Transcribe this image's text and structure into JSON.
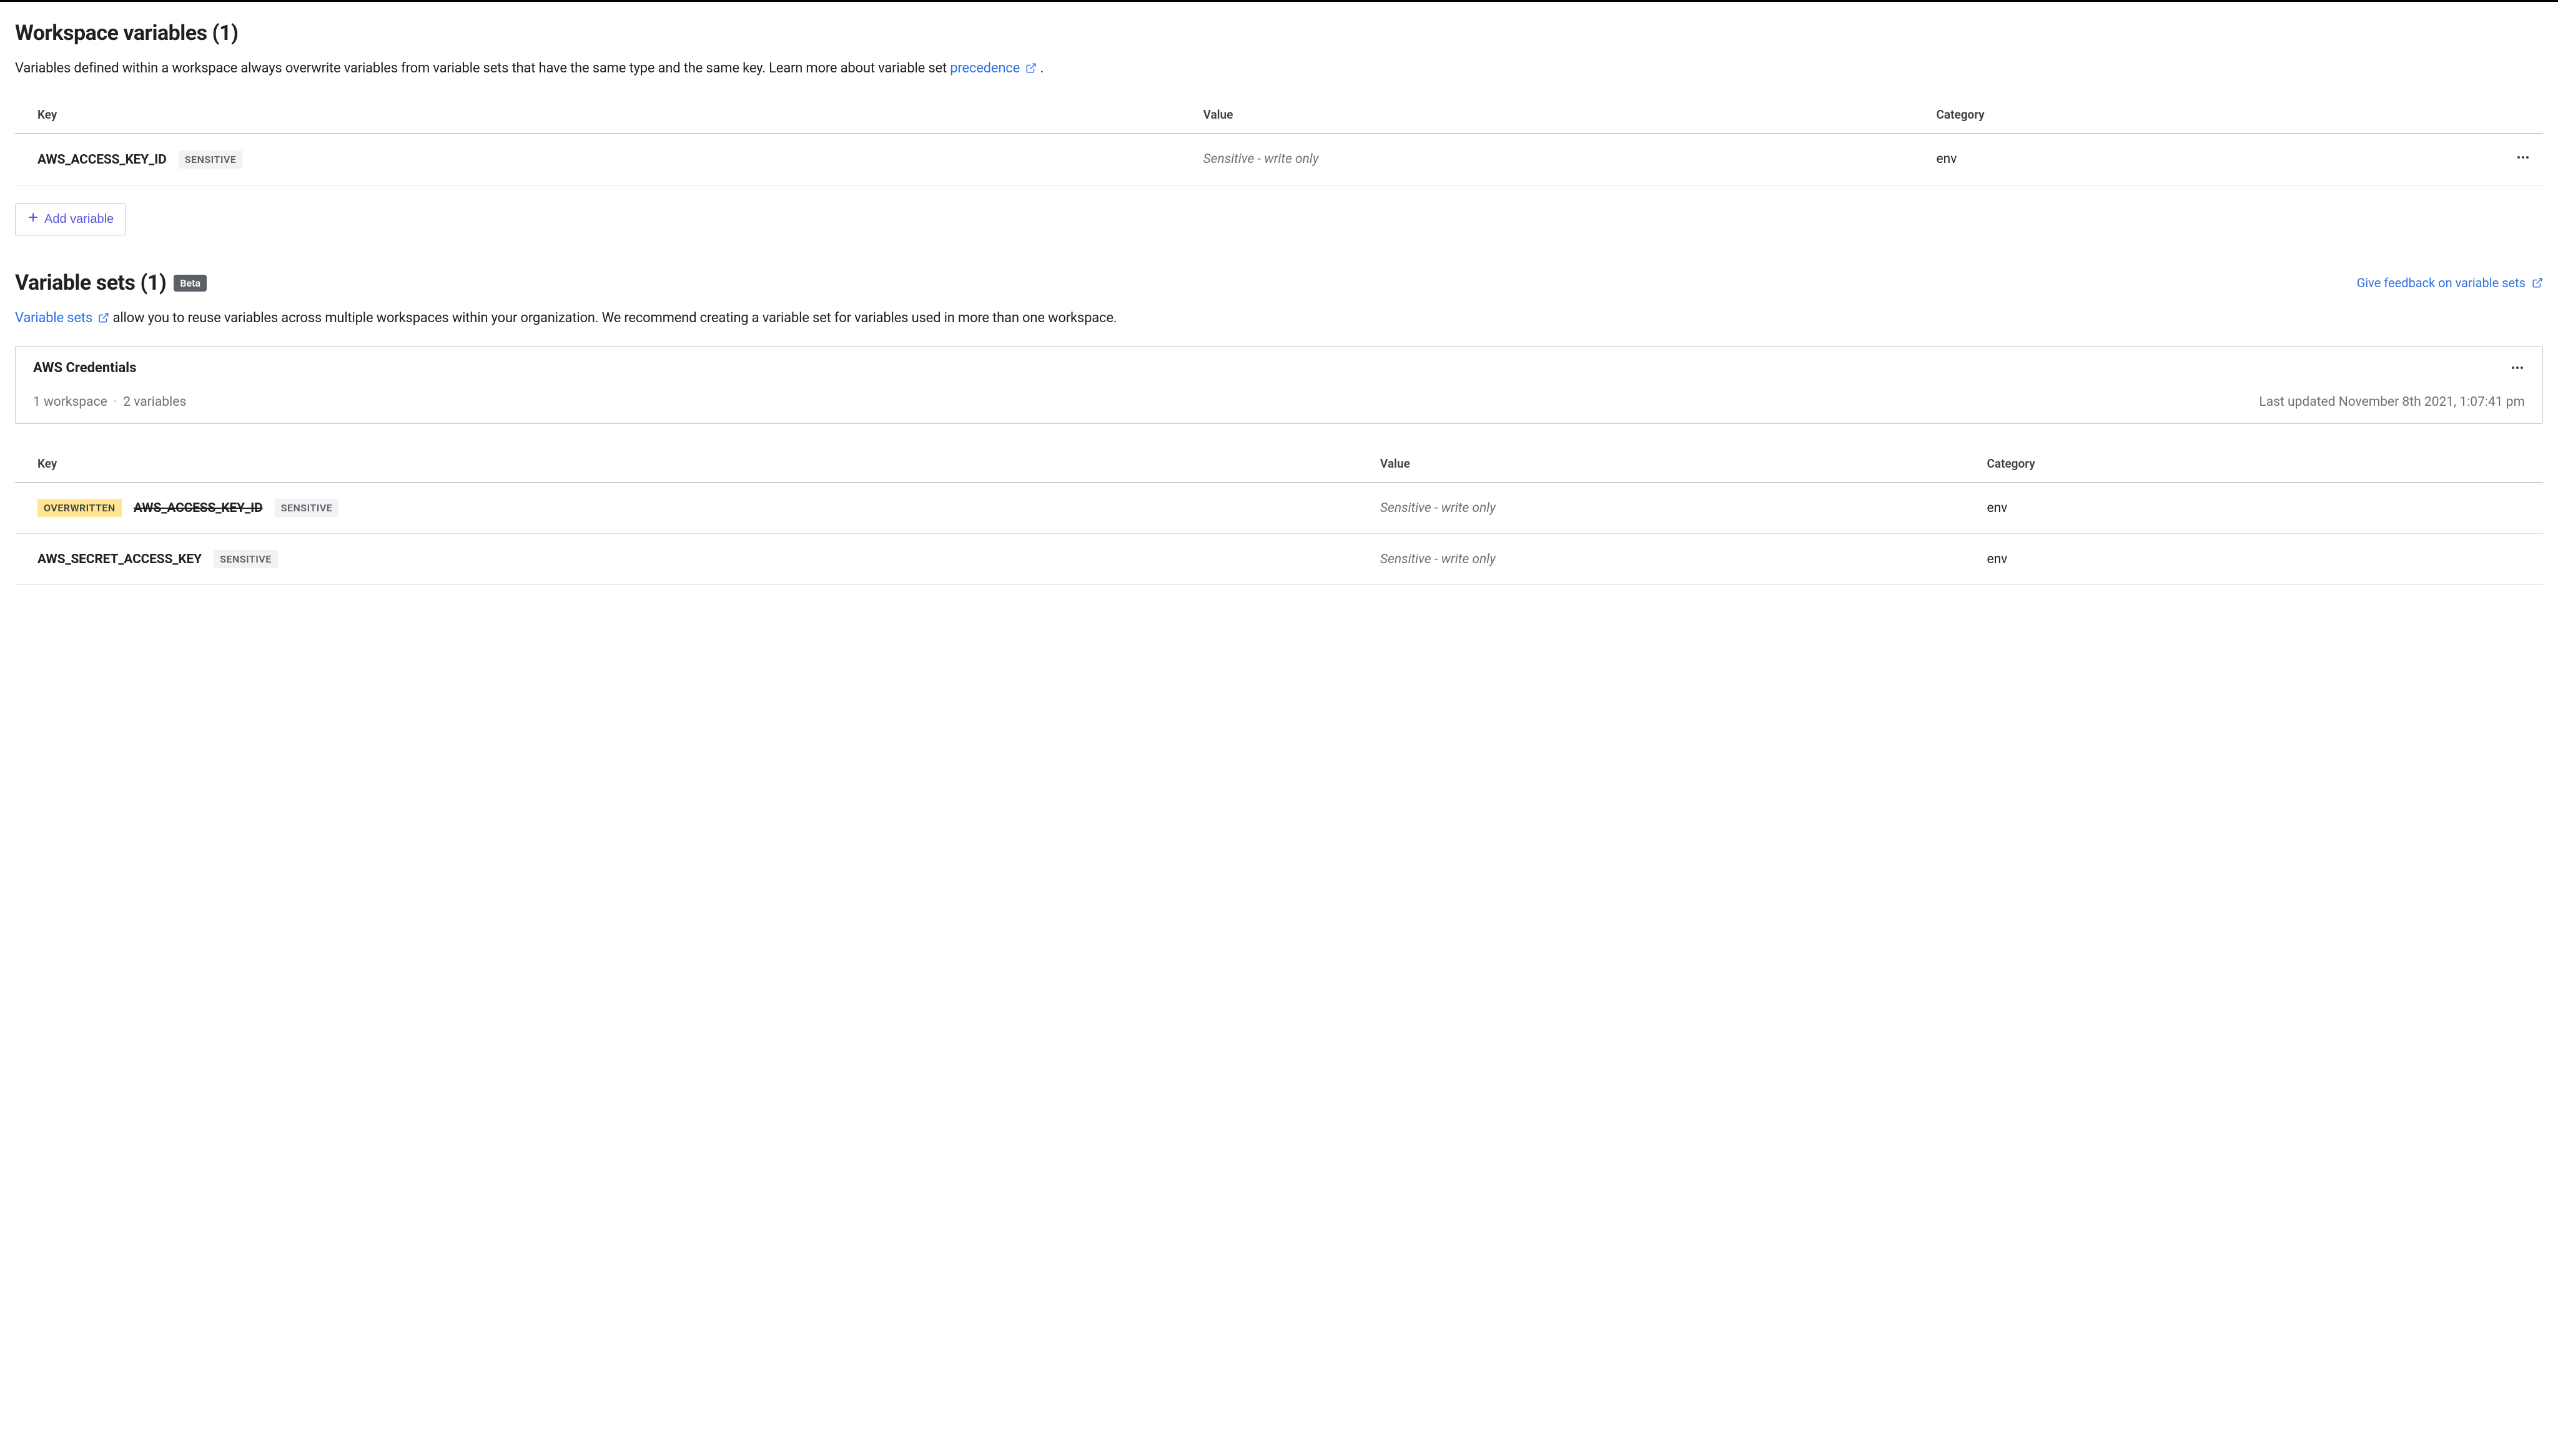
{
  "workspace_vars": {
    "title": "Workspace variables (1)",
    "description_pre": "Variables defined within a workspace always overwrite variables from variable sets that have the same type and the same key. Learn more about variable set ",
    "description_link": "precedence",
    "description_post": ".",
    "columns": {
      "key": "Key",
      "value": "Value",
      "category": "Category"
    },
    "rows": [
      {
        "key": "AWS_ACCESS_KEY_ID",
        "sensitive_label": "SENSITIVE",
        "value": "Sensitive - write only",
        "category": "env"
      }
    ],
    "add_button": "Add variable"
  },
  "variable_sets": {
    "title": "Variable sets (1)",
    "beta_label": "Beta",
    "feedback_label": "Give feedback on variable sets",
    "description_link": "Variable sets",
    "description_post": " allow you to reuse variables across multiple workspaces within your organization. We recommend creating a variable set for variables used in more than one workspace.",
    "set": {
      "name": "AWS Credentials",
      "workspace_count": "1 workspace",
      "variable_count": "2 variables",
      "last_updated": "Last updated November 8th 2021, 1:07:41 pm"
    },
    "columns": {
      "key": "Key",
      "value": "Value",
      "category": "Category"
    },
    "rows": [
      {
        "overwritten_label": "OVERWRITTEN",
        "key": "AWS_ACCESS_KEY_ID",
        "strikethrough": true,
        "sensitive_label": "SENSITIVE",
        "value": "Sensitive - write only",
        "category": "env"
      },
      {
        "key": "AWS_SECRET_ACCESS_KEY",
        "sensitive_label": "SENSITIVE",
        "value": "Sensitive - write only",
        "category": "env"
      }
    ]
  }
}
